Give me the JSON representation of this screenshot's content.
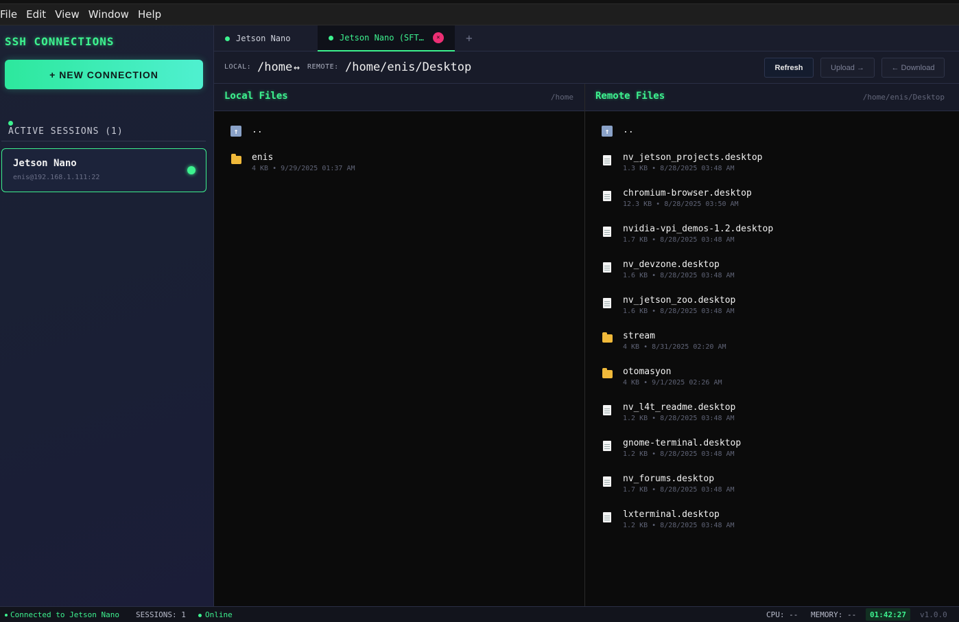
{
  "menu": [
    "File",
    "Edit",
    "View",
    "Window",
    "Help"
  ],
  "sidebar": {
    "title": "SSH CONNECTIONS",
    "new_connection_label": "+ NEW CONNECTION",
    "sessions_heading": "ACTIVE SESSIONS (1)",
    "sessions": [
      {
        "name": "Jetson Nano",
        "address": "enis@192.168.1.111:22",
        "status": "connected"
      }
    ]
  },
  "tabs": [
    {
      "label": "Jetson Nano",
      "active": false
    },
    {
      "label": "Jetson Nano (SFT…",
      "active": true,
      "close": "×"
    }
  ],
  "tab_add_label": "+",
  "pathbar": {
    "local_label": "LOCAL:",
    "local_path": "/home",
    "arrow": "↔",
    "remote_label": "REMOTE:",
    "remote_path": "/home/enis/Desktop",
    "refresh_label": "Refresh",
    "upload_label": "Upload →",
    "download_label": "← Download"
  },
  "local_panel": {
    "title": "Local Files",
    "path": "/home",
    "entries": [
      {
        "icon": "up-icon",
        "name": "..",
        "meta": ""
      },
      {
        "icon": "folder-icon",
        "name": "enis",
        "meta": "4 KB • 9/29/2025 01:37 AM"
      }
    ]
  },
  "remote_panel": {
    "title": "Remote Files",
    "path": "/home/enis/Desktop",
    "entries": [
      {
        "icon": "up-icon",
        "name": "..",
        "meta": ""
      },
      {
        "icon": "file-icon",
        "name": "nv_jetson_projects.desktop",
        "meta": "1.3 KB • 8/28/2025 03:48 AM"
      },
      {
        "icon": "file-icon",
        "name": "chromium-browser.desktop",
        "meta": "12.3 KB • 8/28/2025 03:50 AM"
      },
      {
        "icon": "file-icon",
        "name": "nvidia-vpi_demos-1.2.desktop",
        "meta": "1.7 KB • 8/28/2025 03:48 AM"
      },
      {
        "icon": "file-icon",
        "name": "nv_devzone.desktop",
        "meta": "1.6 KB • 8/28/2025 03:48 AM"
      },
      {
        "icon": "file-icon",
        "name": "nv_jetson_zoo.desktop",
        "meta": "1.6 KB • 8/28/2025 03:48 AM"
      },
      {
        "icon": "folder-icon",
        "name": "stream",
        "meta": "4 KB • 8/31/2025 02:20 AM"
      },
      {
        "icon": "folder-icon",
        "name": "otomasyon",
        "meta": "4 KB • 9/1/2025 02:26 AM"
      },
      {
        "icon": "file-icon",
        "name": "nv_l4t_readme.desktop",
        "meta": "1.2 KB • 8/28/2025 03:48 AM"
      },
      {
        "icon": "file-icon",
        "name": "gnome-terminal.desktop",
        "meta": "1.2 KB • 8/28/2025 03:48 AM"
      },
      {
        "icon": "file-icon",
        "name": "nv_forums.desktop",
        "meta": "1.7 KB • 8/28/2025 03:48 AM"
      },
      {
        "icon": "file-icon",
        "name": "lxterminal.desktop",
        "meta": "1.2 KB • 8/28/2025 03:48 AM"
      }
    ]
  },
  "statusbar": {
    "connection": "Connected to Jetson Nano",
    "sessions": "SESSIONS: 1",
    "online": "Online",
    "cpu": "CPU: --",
    "memory": "MEMORY: --",
    "time": "01:42:27",
    "version": "v1.0.0"
  },
  "colors": {
    "accent": "#3df28f",
    "close": "#ec2f74",
    "folder": "#f0b93a"
  }
}
